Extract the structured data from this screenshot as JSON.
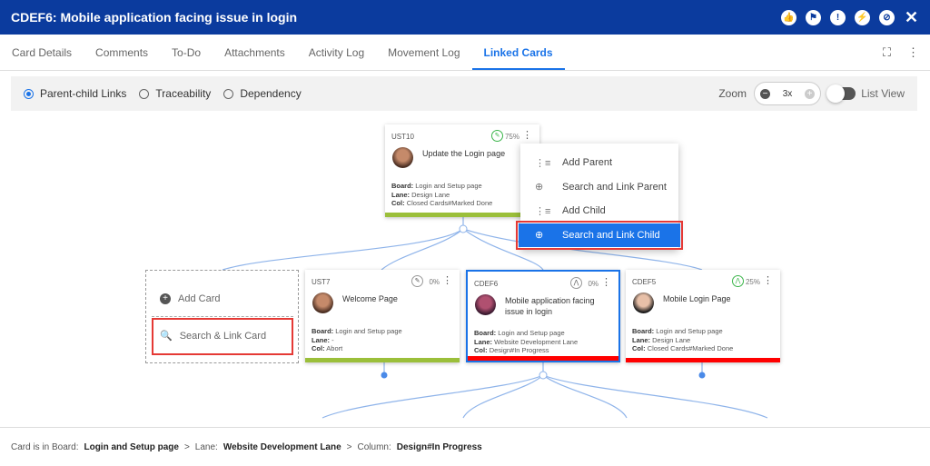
{
  "header": {
    "title": "CDEF6:  Mobile application facing issue in login",
    "icons": [
      "thumbs-up-icon",
      "flag-icon",
      "alert-icon",
      "lightning-icon",
      "block-icon",
      "close-icon"
    ]
  },
  "tabs": [
    "Card Details",
    "Comments",
    "To-Do",
    "Attachments",
    "Activity Log",
    "Movement Log",
    "Linked Cards"
  ],
  "active_tab": "Linked Cards",
  "toolbar": {
    "options": [
      "Parent-child Links",
      "Traceability",
      "Dependency"
    ],
    "zoom_label": "Zoom",
    "zoom_value": "3x",
    "list_view": "List View"
  },
  "parent_card": {
    "id": "UST10",
    "pct": "75%",
    "title": "Update the Login page",
    "board_label": "Board:",
    "board": "Login and Setup page",
    "lane_label": "Lane:",
    "lane": "Design Lane",
    "col_label": "Col:",
    "col": "Closed Cards#Marked Done",
    "bar_color": "#9bbf3a"
  },
  "menu": [
    "Add Parent",
    "Search and Link Parent",
    "Add Child",
    "Search and Link Child"
  ],
  "add_box": {
    "add": "Add Card",
    "search": "Search & Link Card"
  },
  "children": [
    {
      "id": "UST7",
      "pct": "0%",
      "title": "Welcome Page",
      "board_label": "Board:",
      "board": "Login and Setup page",
      "lane_label": "Lane:",
      "lane": "-",
      "col_label": "Col:",
      "col": "Abort",
      "bar_color": "#9bbf3a"
    },
    {
      "id": "CDEF6",
      "pct": "0%",
      "title": "Mobile application facing issue in login",
      "board_label": "Board:",
      "board": "Login and Setup page",
      "lane_label": "Lane:",
      "lane": "Website Development Lane",
      "col_label": "Col:",
      "col": "Design#In Progress",
      "bar_color": "#ff0000"
    },
    {
      "id": "CDEF5",
      "pct": "25%",
      "title": "Mobile Login Page",
      "board_label": "Board:",
      "board": "Login and Setup page",
      "lane_label": "Lane:",
      "lane": "Design Lane",
      "col_label": "Col:",
      "col": "Closed Cards#Marked Done",
      "bar_color": "#ff0000"
    }
  ],
  "footer": {
    "board_label": "Card is in Board:",
    "board": "Login and Setup page",
    "sep": ">",
    "lane_label": "Lane:",
    "lane": "Website Development Lane",
    "col_label": "Column:",
    "col": "Design#In Progress"
  }
}
